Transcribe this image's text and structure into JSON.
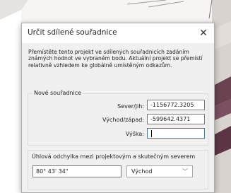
{
  "dialog": {
    "title": "Určit sdílené souřadnice",
    "description": "Přemístěte tento projekt ve sdílených souřadnicích zadáním známých hodnot ve vybraném bodu. Aktuální projekt se přemístí relativně vzhledem ke globálně umístěným odkazům."
  },
  "coordinates": {
    "group_label": "Nové souřadnice",
    "north_south": {
      "label": "Sever/jih:",
      "value": "-1156772.3205"
    },
    "east_west": {
      "label": "Východ/západ:",
      "value": "-599642.4371"
    },
    "elevation": {
      "label": "Výška:",
      "value": ""
    }
  },
  "angle": {
    "label": "Úhlová odchylka mezi projektovým a skutečným severem",
    "value": "80° 43' 34\"",
    "direction": "Východ"
  }
}
